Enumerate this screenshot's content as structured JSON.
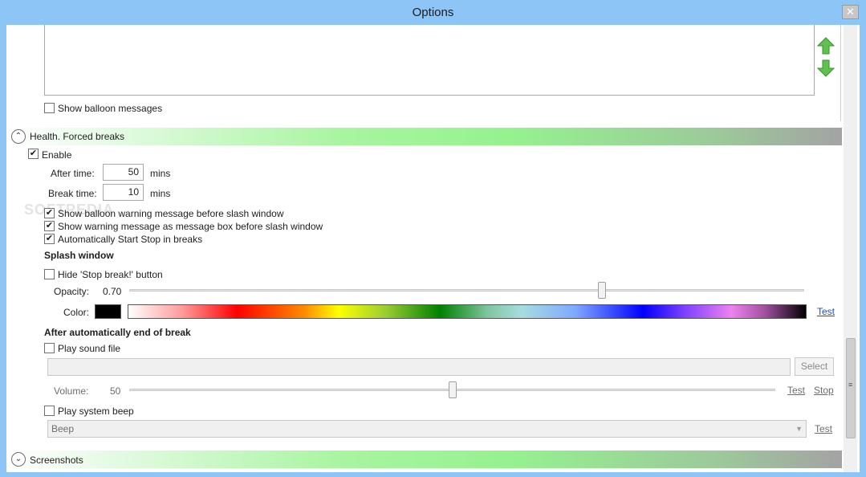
{
  "window": {
    "title": "Options",
    "close_glyph": "✕"
  },
  "balloon": {
    "show_balloon_label": "Show balloon messages",
    "show_balloon_checked": false
  },
  "health_group": {
    "header": "Health. Forced breaks",
    "expander_glyph": "⌃",
    "enable_label": "Enable",
    "enable_checked": true,
    "after_time_label": "After time:",
    "after_time_value": "50",
    "after_time_unit": "mins",
    "break_time_label": "Break time:",
    "break_time_value": "10",
    "break_time_unit": "mins",
    "options": [
      {
        "label": "Show balloon warning message before slash window",
        "checked": true
      },
      {
        "label": "Show warning message as message box before slash window",
        "checked": true
      },
      {
        "label": "Automatically Start Stop in breaks",
        "checked": true
      }
    ]
  },
  "splash": {
    "heading": "Splash window",
    "hide_stop_label": "Hide 'Stop break!' button",
    "hide_stop_checked": false,
    "opacity_label": "Opacity:",
    "opacity_value": "0.70",
    "opacity_level": 0.7,
    "color_label": "Color:",
    "selected_color": "#000000",
    "test_label": "Test"
  },
  "after_break": {
    "heading": "After automatically end of break",
    "play_sound_label": "Play sound file",
    "play_sound_checked": false,
    "sound_path": "",
    "select_label": "Select",
    "volume_label": "Volume:",
    "volume_value": "50",
    "volume_level": 0.5,
    "test_label": "Test",
    "stop_label": "Stop",
    "play_beep_label": "Play system beep",
    "play_beep_checked": false,
    "beep_selected": "Beep",
    "beep_test_label": "Test"
  },
  "screenshots_group": {
    "header": "Screenshots",
    "expander_glyph": "⌄"
  },
  "icons": {
    "move_up": "green-up-arrow-icon",
    "move_down": "green-down-arrow-icon"
  },
  "check_glyph": "✔"
}
